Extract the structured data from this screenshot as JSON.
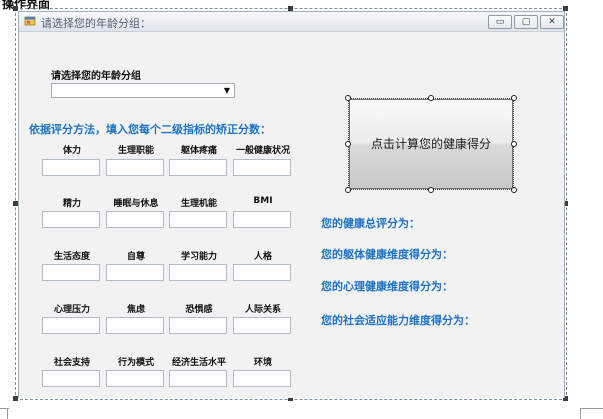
{
  "doc_heading": "操作界面",
  "window": {
    "title": "请选择您的年龄分组：",
    "controls": {
      "minimize": "▭",
      "maximize": "▢",
      "close": "✕"
    }
  },
  "age": {
    "label": "请选择您的年龄分组",
    "selected": ""
  },
  "instruction": "依据评分方法，填入您每个二级指标的矫正分数：",
  "indicators": [
    "体力",
    "生理职能",
    "躯体疼痛",
    "一般健康状况",
    "精力",
    "睡眠与休息",
    "生理机能",
    "BMI",
    "生活态度",
    "自尊",
    "学习能力",
    "人格",
    "心理压力",
    "焦虑",
    "恐惧感",
    "人际关系",
    "社会支持",
    "行为模式",
    "经济生活水平",
    "环境"
  ],
  "calc_button_label": "点击计算您的健康得分",
  "results": [
    "您的健康总评分为：",
    "您的躯体健康维度得分为：",
    "您的心理健康维度得分为：",
    "您的社会适应能力维度得分为："
  ],
  "colors": {
    "accent_text": "#1e73c7",
    "window_bg": "#f2f2f2",
    "titlebar": "#dfe5ec"
  },
  "icons": {
    "app": "form-icon",
    "dropdown": "chevron-down-icon",
    "minimize": "minimize-icon",
    "maximize": "maximize-icon",
    "close": "close-icon"
  }
}
